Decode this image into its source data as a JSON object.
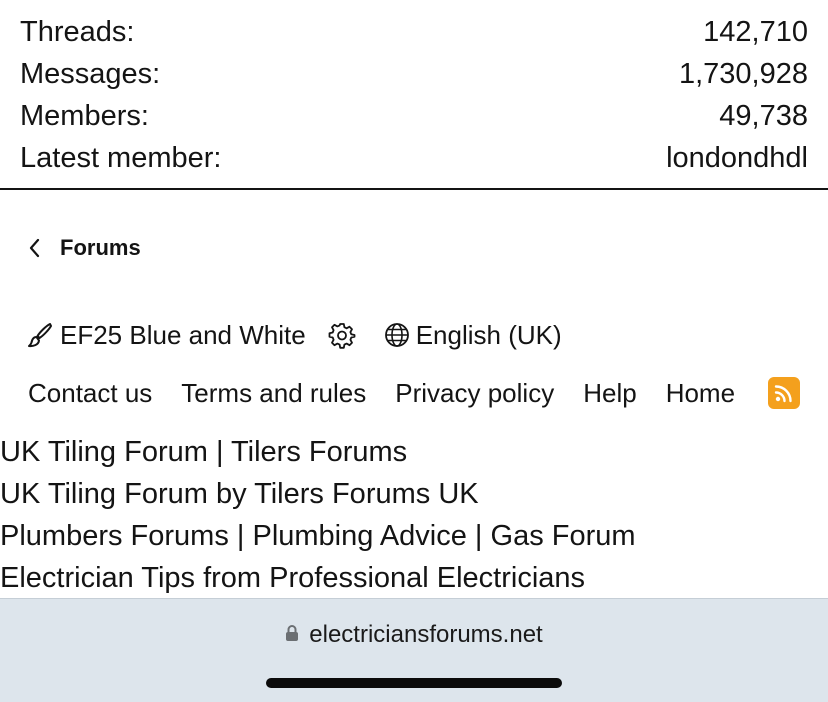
{
  "stats": [
    {
      "label": "Threads:",
      "value": "142,710"
    },
    {
      "label": "Messages:",
      "value": "1,730,928"
    },
    {
      "label": "Members:",
      "value": "49,738"
    },
    {
      "label": "Latest member:",
      "value": "londondhdl"
    }
  ],
  "breadcrumb": {
    "label": "Forums",
    "icon": "chevron-left-icon"
  },
  "style_chooser": {
    "label": "EF25 Blue and White",
    "icon": "paintbrush-icon",
    "settings_icon": "gear-icon"
  },
  "language": {
    "label": "English (UK)",
    "icon": "globe-icon"
  },
  "footer_links": [
    "Contact us",
    "Terms and rules",
    "Privacy policy",
    "Help",
    "Home"
  ],
  "rss": {
    "icon": "rss-icon",
    "color": "#f4a01d"
  },
  "partner_links": [
    "UK Tiling Forum | Tilers Forums",
    "UK Tiling Forum by Tilers Forums UK",
    "Plumbers Forums | Plumbing Advice | Gas Forum",
    "Electrician Tips from Professional Electricians"
  ],
  "browser": {
    "url": "electriciansforums.net",
    "lock_icon": "lock-icon",
    "bar_color": "#dde5ec"
  }
}
